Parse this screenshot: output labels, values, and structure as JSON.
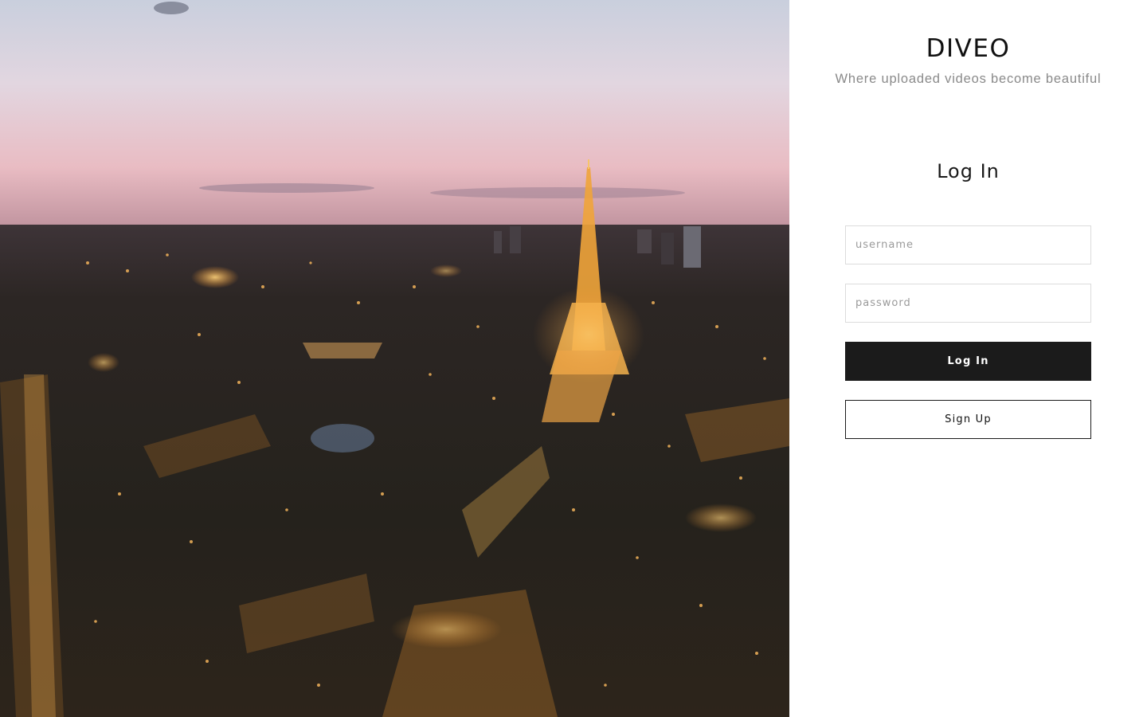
{
  "hero": {
    "image": "paris-eiffel-tower-dusk-photo"
  },
  "brand": {
    "name": "DIVEO",
    "tagline": "Where uploaded videos become beautiful"
  },
  "login": {
    "heading": "Log In",
    "username_placeholder": "username",
    "username_value": "",
    "password_placeholder": "password",
    "password_value": "",
    "login_label": "Log In",
    "signup_label": "Sign Up"
  },
  "colors": {
    "primary_button": "#1b1b1b",
    "tagline": "#8a8a8a",
    "field_border": "#dcdcdc"
  }
}
